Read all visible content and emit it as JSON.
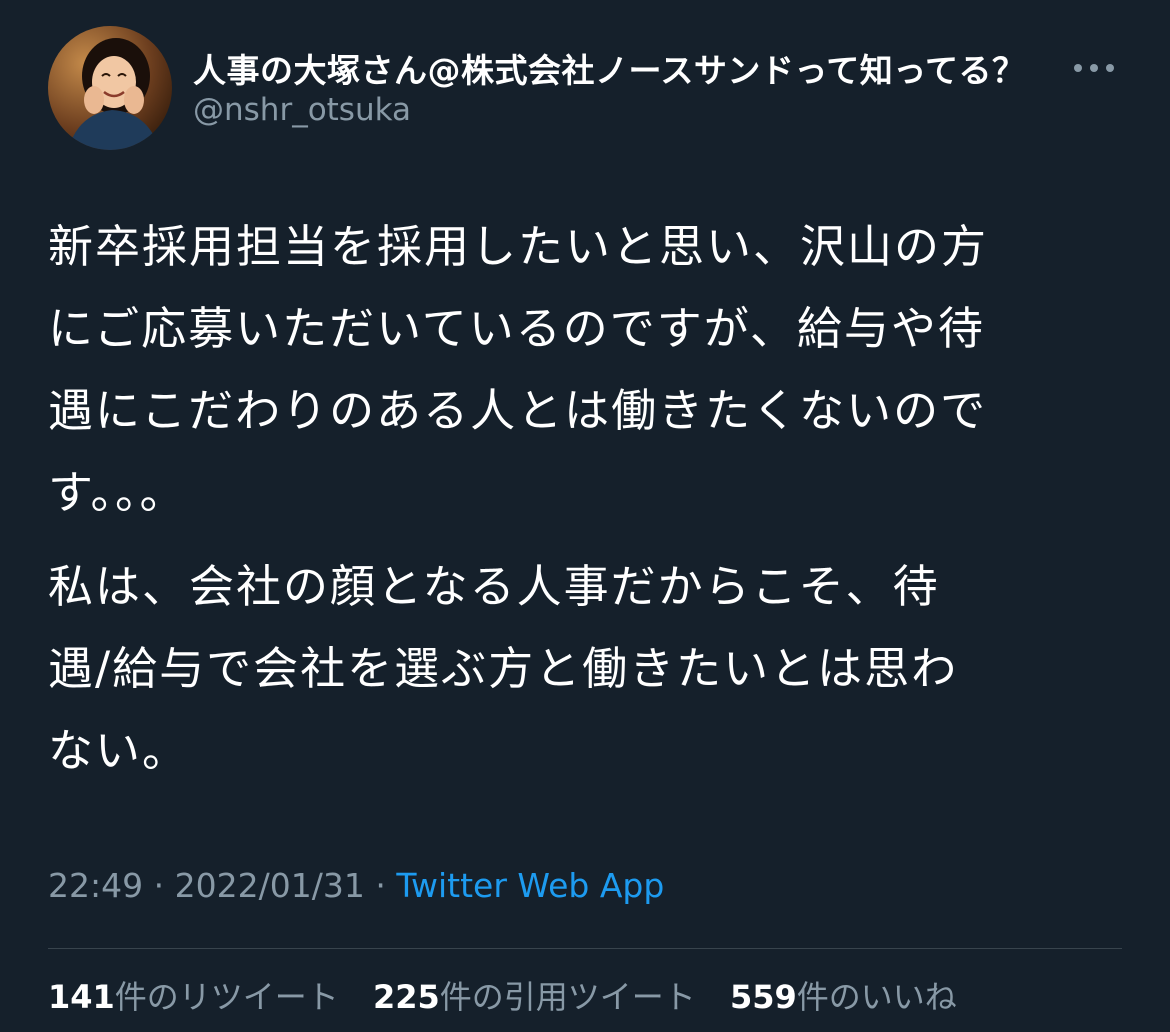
{
  "author": {
    "name": "人事の大塚さん@株式会社ノースサンドって知ってる？",
    "handle": "@nshr_otsuka",
    "avatar": "profile-photo"
  },
  "more_icon": "more-horizontal-icon",
  "tweet": {
    "paragraphs": [
      "新卒採用担当を採用したいと思い、沢山の方\nにご応募いただいているのですが、給与や待\n遇にこだわりのある人とは働きたくないので\nす。。。",
      "私は、会社の顔となる人事だからこそ、待\n遇/給与で会社を選ぶ方と働きたいとは思わ\nない。"
    ]
  },
  "meta": {
    "time": "22:49",
    "separator": "·",
    "date": "2022/01/31",
    "source": "Twitter Web App"
  },
  "stats": {
    "retweets": {
      "count": "141",
      "label": "件のリツイート"
    },
    "quotes": {
      "count": "225",
      "label": "件の引用ツイート"
    },
    "likes": {
      "count": "559",
      "label": "件のいいね"
    }
  },
  "colors": {
    "background": "#15202b",
    "text": "#ffffff",
    "secondary": "#8899a6",
    "link": "#1d9bf0",
    "divider": "#38444d"
  }
}
